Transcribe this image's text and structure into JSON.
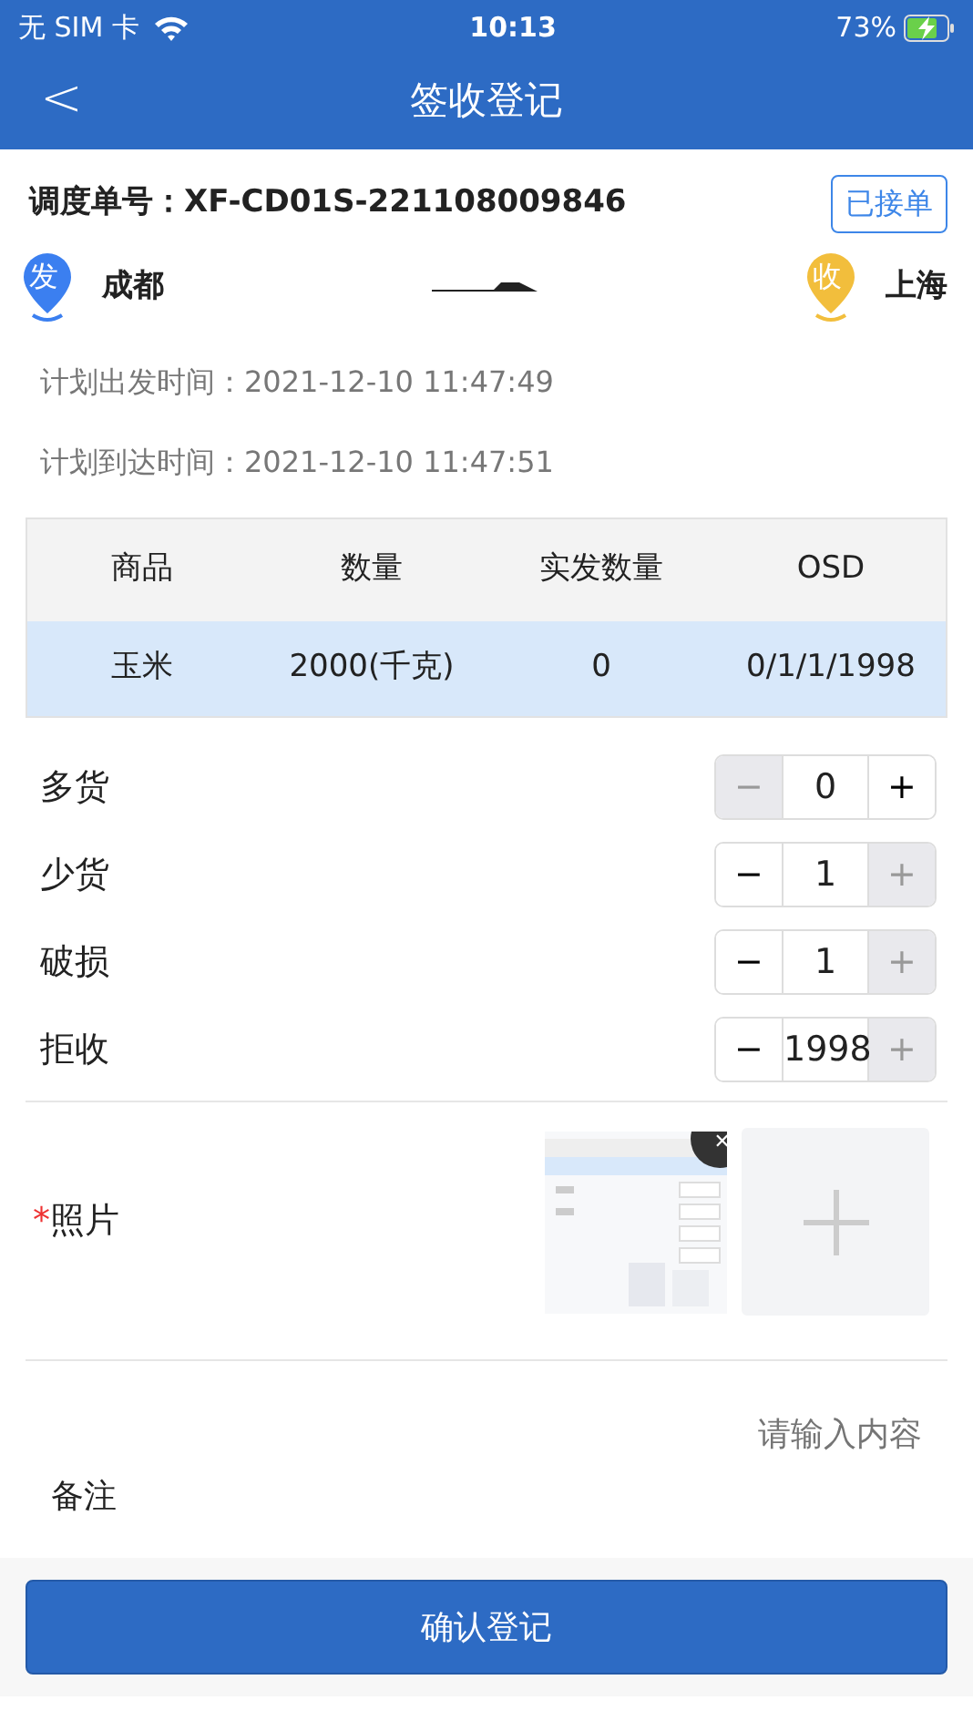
{
  "status_bar": {
    "carrier": "无 SIM 卡",
    "time": "10:13",
    "battery": "73%"
  },
  "nav": {
    "back": "<",
    "title": "签收登记"
  },
  "order": {
    "label": "调度单号：XF-CD01S-221108009846",
    "status": "已接单"
  },
  "route": {
    "from_badge": "发",
    "from": "成都",
    "to_badge": "收",
    "to": "上海"
  },
  "times": [
    "计划出发时间：2021-12-10 11:47:49",
    "计划到达时间：2021-12-10 11:47:51"
  ],
  "table": {
    "columns": [
      "商品",
      "数量",
      "实发数量",
      "OSD"
    ],
    "rows": [
      [
        "玉米",
        "2000(千克)",
        "0",
        "0/1/1/1998"
      ]
    ]
  },
  "counters": [
    {
      "label": "多货",
      "value": "0",
      "minus": "−",
      "plus": "+",
      "minus_disabled": true,
      "plus_disabled": false
    },
    {
      "label": "少货",
      "value": "1",
      "minus": "−",
      "plus": "+",
      "minus_disabled": false,
      "plus_disabled": true
    },
    {
      "label": "破损",
      "value": "1",
      "minus": "−",
      "plus": "+",
      "minus_disabled": false,
      "plus_disabled": true
    },
    {
      "label": "拒收",
      "value": "1998",
      "minus": "−",
      "plus": "+",
      "minus_disabled": false,
      "plus_disabled": true
    }
  ],
  "photo": {
    "required_mark": "*",
    "label": "照片",
    "images": [
      {
        "kind": "picture",
        "close": "✕"
      }
    ]
  },
  "remark": {
    "label": "备注",
    "placeholder": "请输入内容"
  },
  "submit": "确认登记"
}
